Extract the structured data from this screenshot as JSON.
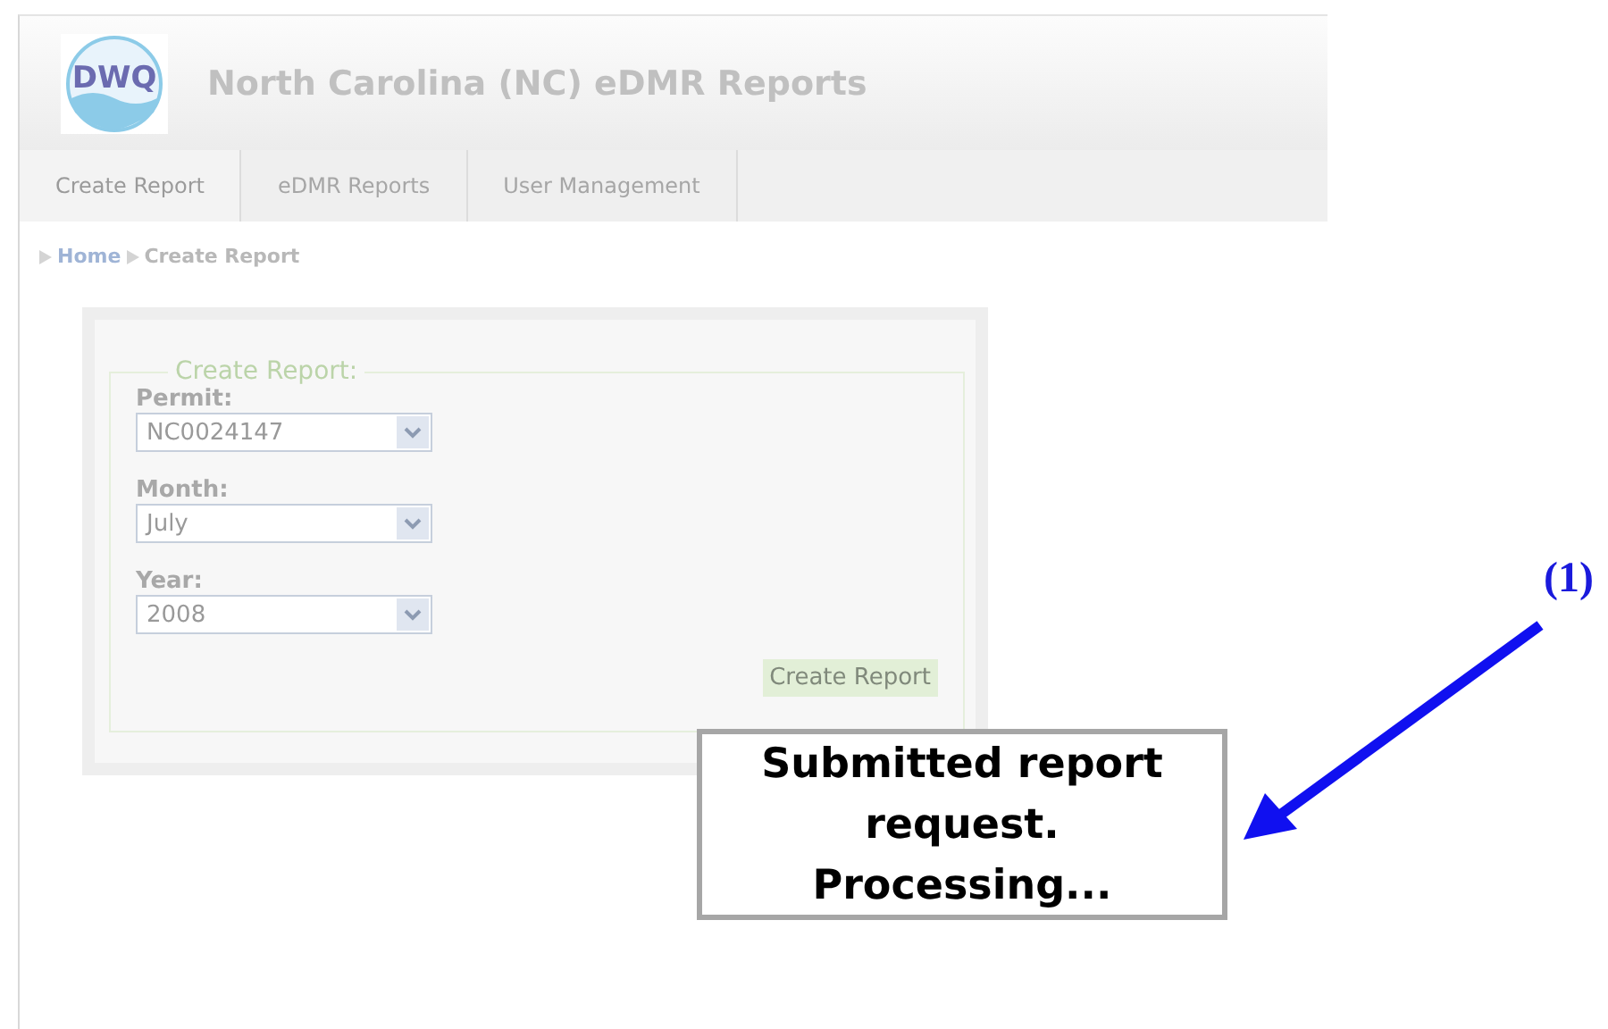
{
  "header": {
    "logo_text": "DWQ",
    "title": "North Carolina (NC) eDMR Reports"
  },
  "nav": [
    {
      "label": "Create Report",
      "selected": true
    },
    {
      "label": "eDMR Reports",
      "selected": false
    },
    {
      "label": "User Management",
      "selected": false
    }
  ],
  "breadcrumb": [
    "Home",
    "Create Report"
  ],
  "form": {
    "legend": "Create Report:",
    "disabled": true,
    "fields": [
      {
        "label": "Permit:",
        "value": "NC0024147"
      },
      {
        "label": "Month:",
        "value": "July"
      },
      {
        "label": "Year:",
        "value": "2008"
      }
    ],
    "button": "Create Report"
  },
  "popup": {
    "lines": [
      "Submitted report",
      "request.",
      "Processing..."
    ]
  },
  "annotation": {
    "label": "(1)"
  }
}
